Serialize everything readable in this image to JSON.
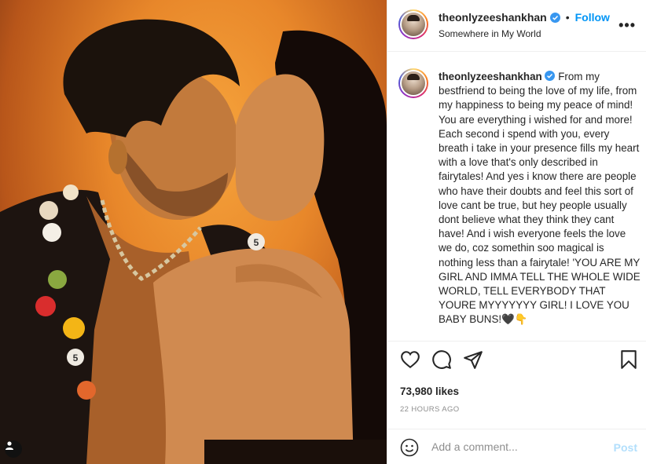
{
  "post": {
    "username": "theonlyzeeshankhan",
    "verified": true,
    "follow_label": "Follow",
    "separator": "•",
    "location": "Somewhere in My World",
    "more_label": "•••",
    "caption": "From my bestfriend to being the love of my life, from my happiness to being my peace of mind! You are everything i wished for and more! Each second i spend with you, every breath i take in your presence fills my heart with a love that's only described in fairytales! And yes i know there are people who have their doubts and feel this sort of love cant be true, but hey people usually dont believe what they think they cant have! And i wish everyone feels the love we do, coz somethin soo magical is nothing less than a fairytale! 'YOU ARE MY GIRL AND IMMA TELL THE WHOLE WIDE WORLD, TELL EVERYBODY THAT YOURE MYYYYYYY GIRL! I LOVE YOU BABY BUNS!🖤👇",
    "likes": "73,980 likes",
    "time": "22 HOURS AGO"
  },
  "comment": {
    "placeholder": "Add a comment...",
    "post_label": "Post"
  },
  "icons": {
    "like": "heart-icon",
    "comment": "comment-icon",
    "share": "paper-plane-icon",
    "save": "bookmark-icon",
    "emoji": "smiley-icon",
    "tagged_user": "user-icon",
    "verified": "verified-badge-icon"
  },
  "colors": {
    "accent": "#0095f6",
    "text": "#262626",
    "muted": "#8e8e8e",
    "post_disabled": "#b2dffc",
    "border": "#efefef"
  }
}
